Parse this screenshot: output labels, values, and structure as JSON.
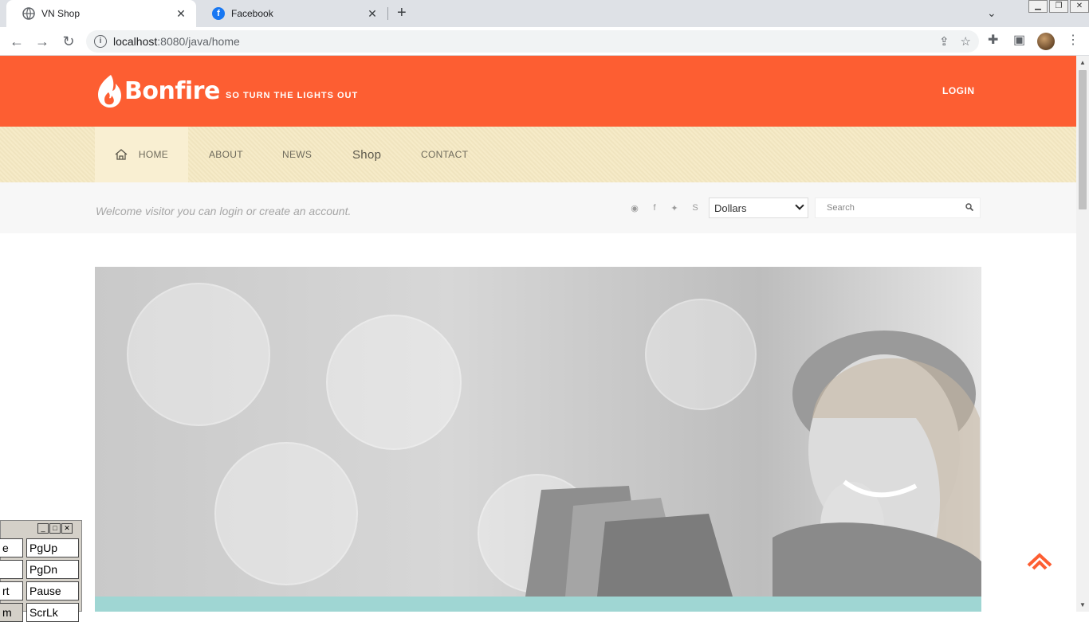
{
  "browser": {
    "tabs": [
      {
        "title": "VN Shop",
        "active": true
      },
      {
        "title": "Facebook",
        "active": false
      }
    ],
    "url_host": "localhost",
    "url_path": ":8080/java/home"
  },
  "site": {
    "logo": "Bonfire",
    "tagline": "SO TURN THE LIGHTS OUT",
    "login": "LOGIN",
    "nav": [
      "HOME",
      "ABOUT",
      "NEWS",
      "Shop",
      "CONTACT"
    ],
    "welcome": "Welcome visitor you can login or create an account.",
    "currency": "Dollars",
    "search_placeholder": "Search"
  },
  "keyboard": {
    "keys": [
      "e",
      "PgUp",
      "PgDn",
      "rt",
      "Pause",
      "m",
      "ScrLk"
    ]
  },
  "colors": {
    "brand": "#fd5e32",
    "nav_bg": "#f5e9c3",
    "accent_teal": "#9fd6d3"
  }
}
